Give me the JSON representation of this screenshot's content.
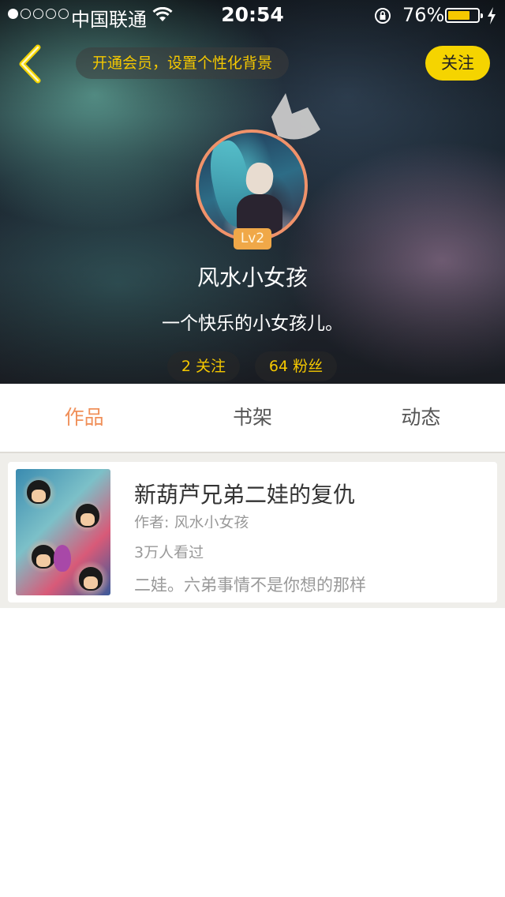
{
  "status_bar": {
    "carrier": "中国联通",
    "time": "20:54",
    "battery_percent": "76%",
    "battery_level": 0.76,
    "signal_bars_filled": 1,
    "signal_bars_total": 5,
    "icons": [
      "signal-dots-icon",
      "wifi-icon",
      "rotation-lock-icon",
      "battery-icon",
      "charging-bolt-icon"
    ]
  },
  "nav": {
    "back_icon": "chevron-left-icon",
    "vip_banner": "开通会员，设置个性化背景",
    "follow_button": "关注"
  },
  "profile": {
    "crown_icon": "crown-icon",
    "level": "Lv2",
    "username": "风水小女孩",
    "bio": "一个快乐的小女孩儿。",
    "following": "2 关注",
    "fans": "64 粉丝"
  },
  "tabs": [
    {
      "label": "作品",
      "active": true
    },
    {
      "label": "书架",
      "active": false
    },
    {
      "label": "动态",
      "active": false
    }
  ],
  "works": [
    {
      "title": "新葫芦兄弟二娃的复仇",
      "author": "作者: 风水小女孩",
      "views": "3万人看过",
      "description": "二娃。六弟事情不是你想的那样"
    }
  ],
  "colors": {
    "accent_yellow": "#f5c800",
    "accent_orange": "#f0905a",
    "level_badge": "#f0a848"
  }
}
